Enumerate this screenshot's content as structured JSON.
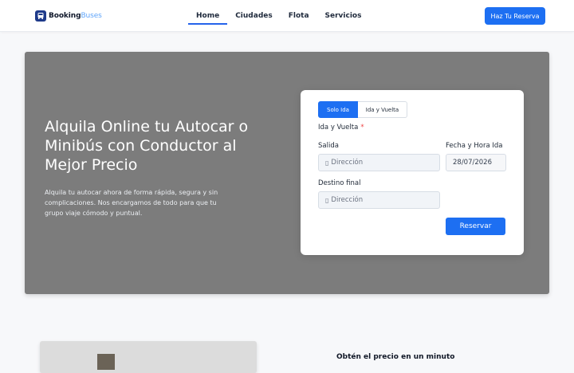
{
  "brand": {
    "name_part1": "Booking",
    "name_part2": "Buses"
  },
  "nav": {
    "items": [
      {
        "label": "Home",
        "active": true
      },
      {
        "label": "Ciudades",
        "active": false
      },
      {
        "label": "Flota",
        "active": false
      },
      {
        "label": "Servicios",
        "active": false
      }
    ],
    "cta_label": "Haz Tu Reserva"
  },
  "hero": {
    "title": "Alquila Online tu Autocar o Minibús con Conductor al Mejor Precio",
    "subtitle": "Alquila tu autocar ahora de forma rápida, segura y sin complicaciones. Nos encargamos de todo para que tu grupo viaje cómodo y puntual."
  },
  "booking": {
    "tabs": [
      {
        "label": "Solo Ida",
        "selected": true
      },
      {
        "label": "Ida y Vuelta",
        "selected": false
      }
    ],
    "trip_type_label": "Ida y Vuelta",
    "required_mark": "*",
    "departure_label": "Salida",
    "departure_placeholder": "Dirección",
    "date_label": "Fecha y Hora Ida",
    "date_value": "28/07/2026",
    "destination_label": "Destino final",
    "destination_placeholder": "Dirección",
    "reserve_label": "Reservar"
  },
  "section2": {
    "title": "Obtén el precio en un minuto"
  },
  "colors": {
    "primary": "#1d6ff2",
    "hero_bg": "#7c7c7c",
    "required": "#ef4444"
  }
}
